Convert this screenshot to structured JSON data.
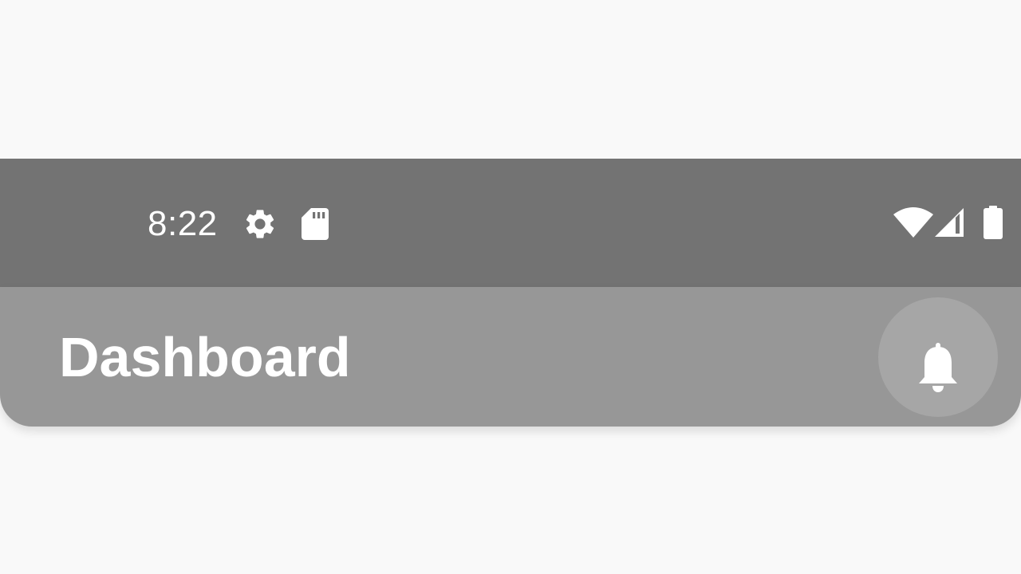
{
  "status_bar": {
    "time": "8:22",
    "left_icons": [
      "gear-icon",
      "sd-card-icon"
    ],
    "right_icons": [
      "wifi-icon",
      "cell-signal-icon",
      "battery-icon"
    ]
  },
  "app_bar": {
    "title": "Dashboard",
    "action_icon": "bell-icon"
  },
  "colors": {
    "page_background": "#f9f9f9",
    "status_bar": "#737373",
    "app_bar": "#979797",
    "icon_button": "#a6a6a6",
    "foreground": "#ffffff"
  }
}
